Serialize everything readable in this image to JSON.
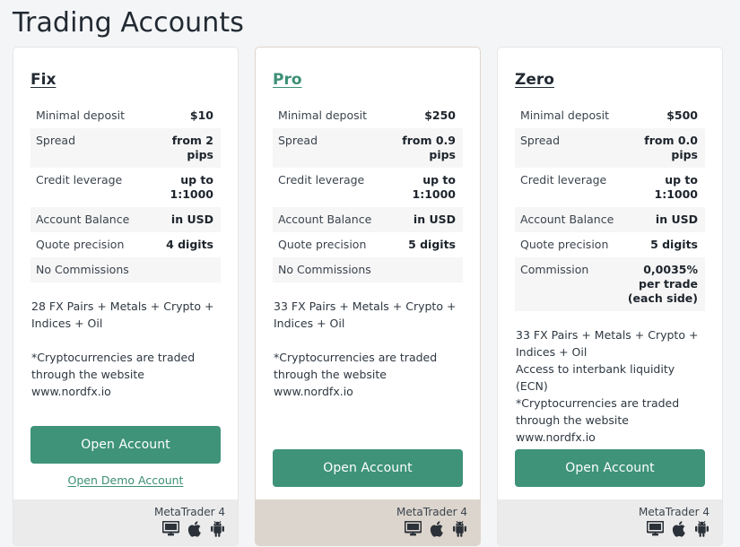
{
  "page": {
    "title": "Trading Accounts",
    "background_color": "#f4f5f7",
    "accent_color": "#3e9379"
  },
  "table_headers": {
    "minimal_deposit": "Minimal deposit",
    "spread": "Spread",
    "credit_leverage": "Credit leverage",
    "account_balance": "Account Balance",
    "quote_precision": "Quote precision",
    "commission": "Commission"
  },
  "cards": [
    {
      "title": "Fix",
      "title_color": "#222a33",
      "highlighted": false,
      "specs": [
        {
          "label": "Minimal deposit",
          "value": "$10"
        },
        {
          "label": "Spread",
          "value": "from 2 pips"
        },
        {
          "label": "Credit leverage",
          "value": "up to 1:1000"
        },
        {
          "label": "Account Balance",
          "value": "in USD"
        },
        {
          "label": "Quote precision",
          "value": "4 digits"
        },
        {
          "label": "No Commissions",
          "value": ""
        }
      ],
      "notes": "28 FX Pairs + Metals + Crypto + Indices + Oil\n\n*Cryptocurrencies are traded through the website www.nordfx.io",
      "cta_label": "Open Account",
      "demo_link_label": "Open Demo Account",
      "platform": "MetaTrader 4",
      "platform_icons": [
        "desktop-icon",
        "apple-icon",
        "android-icon"
      ],
      "footer_color": "#ebebeb"
    },
    {
      "title": "Pro",
      "title_color": "#3c8f76",
      "highlighted": true,
      "specs": [
        {
          "label": "Minimal deposit",
          "value": "$250"
        },
        {
          "label": "Spread",
          "value": "from 0.9 pips"
        },
        {
          "label": "Credit leverage",
          "value": "up to 1:1000"
        },
        {
          "label": "Account Balance",
          "value": "in USD"
        },
        {
          "label": "Quote precision",
          "value": "5 digits"
        },
        {
          "label": "No Commissions",
          "value": ""
        }
      ],
      "notes": "33 FX Pairs + Metals + Crypto + Indices + Oil\n\n*Cryptocurrencies are traded through the website www.nordfx.io",
      "cta_label": "Open Account",
      "demo_link_label": "",
      "platform": "MetaTrader 4",
      "platform_icons": [
        "desktop-icon",
        "apple-icon",
        "android-icon"
      ],
      "footer_color": "#dcd5cd"
    },
    {
      "title": "Zero",
      "title_color": "#222a33",
      "highlighted": false,
      "specs": [
        {
          "label": "Minimal deposit",
          "value": "$500"
        },
        {
          "label": "Spread",
          "value": "from 0.0 pips"
        },
        {
          "label": "Credit leverage",
          "value": "up to 1:1000"
        },
        {
          "label": "Account Balance",
          "value": "in USD"
        },
        {
          "label": "Quote precision",
          "value": "5 digits"
        },
        {
          "label": "Commission",
          "value": "0,0035% per trade (each side)"
        }
      ],
      "notes": "33 FX Pairs + Metals + Crypto + Indices + Oil\nAccess to interbank liquidity (ECN)\n*Cryptocurrencies are traded through the website www.nordfx.io",
      "cta_label": "Open Account",
      "demo_link_label": "",
      "platform": "MetaTrader 4",
      "platform_icons": [
        "desktop-icon",
        "apple-icon",
        "android-icon"
      ],
      "footer_color": "#ebebeb"
    }
  ]
}
